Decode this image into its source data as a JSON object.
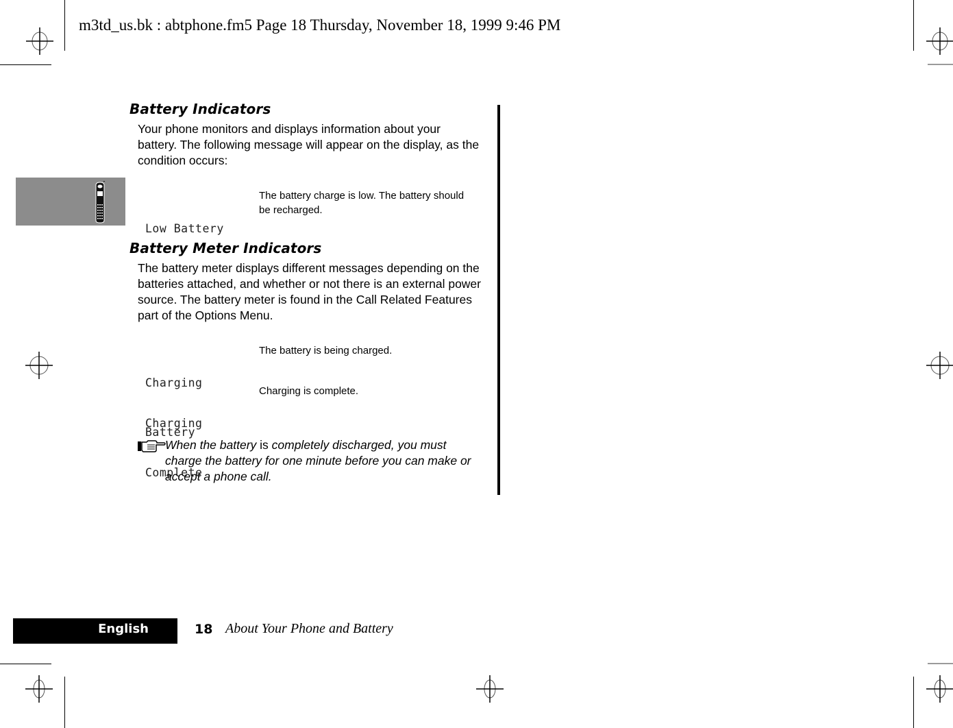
{
  "print_header": {
    "text": "m3td_us.bk : abtphone.fm5  Page 18  Thursday, November 18, 1999  9:46 PM"
  },
  "sections": [
    {
      "heading": "Battery Indicators",
      "intro_lines": [
        "Your phone monitors and displays information about your",
        "battery. The following message will appear on the display, as the",
        "condition occurs:"
      ],
      "messages": [
        {
          "display_lines": [
            "Low Battery"
          ],
          "description_lines": [
            "The battery charge is low. The battery should",
            "be recharged."
          ]
        }
      ]
    },
    {
      "heading": "Battery Meter Indicators",
      "intro_lines": [
        "The battery meter displays different messages depending on the",
        "batteries attached, and whether or not there is an external power",
        "source. The battery meter is found in the Call Related Features",
        "part of the Options Menu."
      ],
      "messages": [
        {
          "display_lines": [
            "Charging",
            "Battery"
          ],
          "description_lines": [
            "The battery is being charged."
          ]
        },
        {
          "display_lines": [
            "Charging",
            "Complete"
          ],
          "description_lines": [
            "Charging is complete."
          ]
        }
      ]
    }
  ],
  "note": {
    "icon": "pointing-hand-icon",
    "part1": "When the battery ",
    "part2": "is",
    "part3": " completely discharged, you must",
    "line2": "charge the battery for one minute before you can make or",
    "line3": "accept a phone call."
  },
  "side_tab": {
    "icon": "mobile-phone-icon",
    "color": "#8c8c8c"
  },
  "footer": {
    "language": "English",
    "page_number": "18",
    "chapter_title": "About Your Phone and Battery"
  }
}
